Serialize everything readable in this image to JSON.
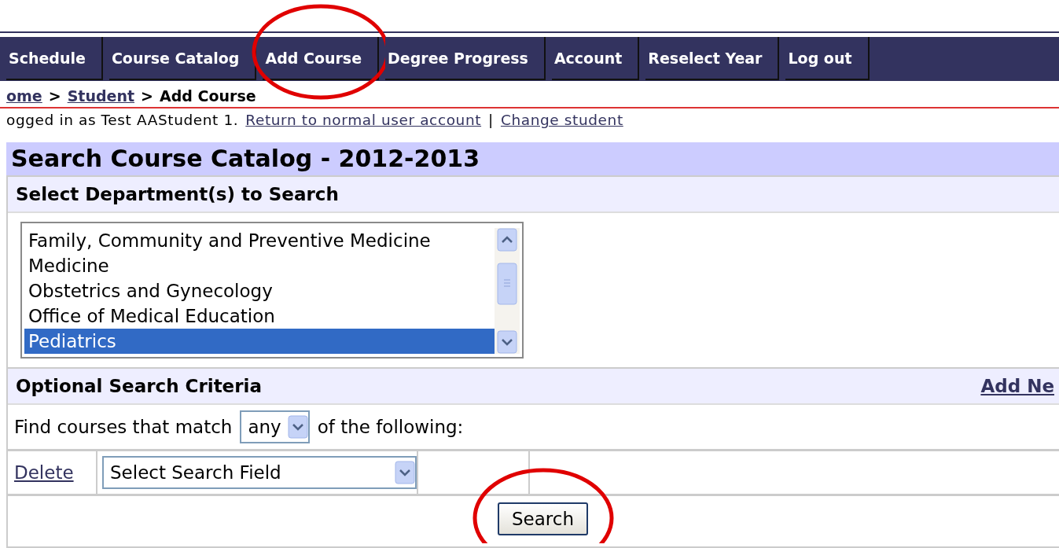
{
  "nav": {
    "tabs": [
      {
        "label": "Schedule",
        "circled": false
      },
      {
        "label": "Course Catalog",
        "circled": false
      },
      {
        "label": "Add Course",
        "circled": true
      },
      {
        "label": "Degree Progress",
        "circled": false
      },
      {
        "label": "Account",
        "circled": false
      },
      {
        "label": "Reselect Year",
        "circled": false
      },
      {
        "label": "Log out",
        "circled": false
      }
    ]
  },
  "breadcrumb": {
    "links": [
      "ome",
      "Student"
    ],
    "separator": ">",
    "current": "Add Course"
  },
  "login_bar": {
    "text": "ogged in as Test AAStudent 1.",
    "links": [
      "Return to normal user account",
      "Change student"
    ],
    "separator": "|"
  },
  "title": "Search Course Catalog - 2012-2013",
  "departments": {
    "heading": "Select Department(s) to Search",
    "items": [
      {
        "label": "Family, Community and Preventive Medicine",
        "selected": false
      },
      {
        "label": "Medicine",
        "selected": false
      },
      {
        "label": "Obstetrics and Gynecology",
        "selected": false
      },
      {
        "label": "Office of Medical Education",
        "selected": false
      },
      {
        "label": "Pediatrics",
        "selected": true
      }
    ]
  },
  "criteria": {
    "heading": "Optional Search Criteria",
    "add_link": "Add Ne",
    "match_before": "Find courses that match",
    "match_value": "any",
    "match_after": "of the following:",
    "rows": [
      {
        "delete": "Delete",
        "field": "Select Search Field"
      }
    ]
  },
  "search_button": {
    "label": "Search",
    "circled": true
  }
}
